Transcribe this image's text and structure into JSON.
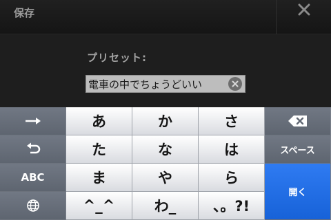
{
  "topbar": {
    "save_label": "保存",
    "close_icon": "close-icon"
  },
  "preset": {
    "label": "プリセット:",
    "value": "電車の中でちょうどいい"
  },
  "keyboard": {
    "rows": [
      [
        "あ",
        "か",
        "さ"
      ],
      [
        "た",
        "な",
        "は"
      ],
      [
        "ま",
        "や",
        "ら"
      ],
      [
        "^_^",
        "わ_",
        "、。?!"
      ]
    ],
    "left_keys": {
      "arrow_icon": "right-arrow-icon",
      "undo_icon": "undo-icon",
      "abc_label": "ABC",
      "globe_icon": "globe-icon"
    },
    "right_keys": {
      "delete_icon": "delete-icon",
      "space_label": "スペース",
      "open_label": "開く"
    }
  },
  "colors": {
    "accent_blue": "#1f6ee6",
    "key_dark": "#687080",
    "key_light": "#f0f1f3"
  }
}
